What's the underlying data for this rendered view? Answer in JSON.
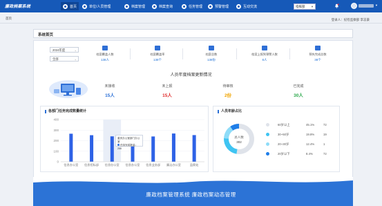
{
  "app": {
    "title": "廉政档案系统"
  },
  "nav": [
    {
      "label": "首页",
      "icon": "home-icon"
    },
    {
      "label": "单位/人员管理",
      "icon": "users-icon"
    },
    {
      "label": "档案管理",
      "icon": "folder-icon"
    },
    {
      "label": "档案查询",
      "icon": "search-icon"
    },
    {
      "label": "任务管理",
      "icon": "task-icon"
    },
    {
      "label": "预警管理",
      "icon": "warning-icon"
    },
    {
      "label": "互动交流",
      "icon": "chat-icon"
    }
  ],
  "header": {
    "select_value": "指挥部",
    "user_avatar_icon": "avatar-icon",
    "bell_icon": "bell-icon"
  },
  "breadcrumb": "首页",
  "login_info": "登录人：纪检监察部  李志豪",
  "panel": {
    "title": "系统首页"
  },
  "filters": {
    "year": "2024年度",
    "unit": "全部"
  },
  "stats": [
    {
      "label": "档案覆盖人数",
      "value": "138人"
    },
    {
      "label": "档案覆盖率",
      "value": "138个"
    },
    {
      "label": "档案总数",
      "value": "138份"
    },
    {
      "label": "档案上报到预警人数",
      "value": "8人"
    },
    {
      "label": "预先完成总数",
      "value": "38个"
    }
  ],
  "update_section": {
    "title": "人员年度档案更新情况",
    "items": [
      {
        "label": "未接收",
        "value": "15人",
        "color": "#2a6fd6"
      },
      {
        "label": "未上报",
        "value": "15人",
        "color": "#e02b2b"
      },
      {
        "label": "待审核",
        "value": "2份",
        "color": "#f0a400"
      },
      {
        "label": "已完成",
        "value": "30人",
        "color": "#2aa84a"
      }
    ]
  },
  "bar_card": {
    "title": "各部门任务完成数量统计"
  },
  "pie_card": {
    "title": "人员年龄占比"
  },
  "tooltip": {
    "line1": "重庆办公室部门办公室",
    "line2": "任务完成数量：",
    "value": "266"
  },
  "chart_data": [
    {
      "type": "bar",
      "title": "各部门任务完成数量统计",
      "categories": [
        "信息办公室",
        "信息招标部",
        "信息办公室",
        "信息办公室",
        "信息业务部",
        "廉洁办公室",
        "监察处"
      ],
      "values": [
        266,
        252,
        241,
        256,
        240,
        268,
        253
      ],
      "ylim": [
        0,
        400
      ],
      "yticks": [
        0,
        100,
        200,
        300,
        400
      ],
      "grid": true,
      "color": "#2e62e6"
    },
    {
      "type": "pie",
      "title": "人员年龄占比",
      "center_label": "总人数",
      "center_value": "302",
      "labels": [
        "60岁以上",
        "30~50岁",
        "20~30岁",
        "20岁以下"
      ],
      "percents": [
        "45.1%",
        "19.8%",
        "12.4%",
        "8.4%"
      ],
      "counts": [
        72,
        19,
        1,
        72
      ],
      "values": [
        45.1,
        19.8,
        12.4,
        8.4
      ],
      "colors": [
        "#dfe3ea",
        "#3fc4f2",
        "#8edcf8",
        "#1f7ee8"
      ]
    }
  ],
  "footer": {
    "text": "廉政档案管理系统   廉政档案动态管理"
  }
}
